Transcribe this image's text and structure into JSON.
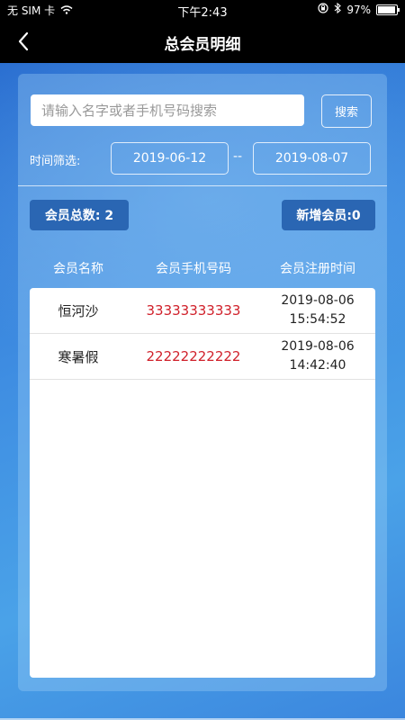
{
  "status_bar": {
    "carrier": "无 SIM 卡",
    "time": "下午2:43",
    "battery": "97%",
    "battery_level": 0.97
  },
  "nav": {
    "title": "总会员明细",
    "back_icon": "chevron-left-icon"
  },
  "search": {
    "placeholder": "请输入名字或者手机号码搜索",
    "value": "",
    "button_label": "搜索"
  },
  "filter": {
    "label": "时间筛选:",
    "start_date": "2019-06-12",
    "separator": "--",
    "end_date": "2019-08-07"
  },
  "summary": {
    "total_label": "会员总数: 2",
    "new_label": "新增会员:0"
  },
  "table": {
    "headers": [
      "会员名称",
      "会员手机号码",
      "会员注册时间"
    ],
    "rows": [
      {
        "name": "恒河沙",
        "phone": "33333333333",
        "date": "2019-08-06",
        "time": "15:54:52"
      },
      {
        "name": "寒暑假",
        "phone": "22222222222",
        "date": "2019-08-06",
        "time": "14:42:40"
      }
    ]
  },
  "colors": {
    "badge": "#2a66b3",
    "phone_text": "#d0202a",
    "nav_background": "#000000"
  }
}
